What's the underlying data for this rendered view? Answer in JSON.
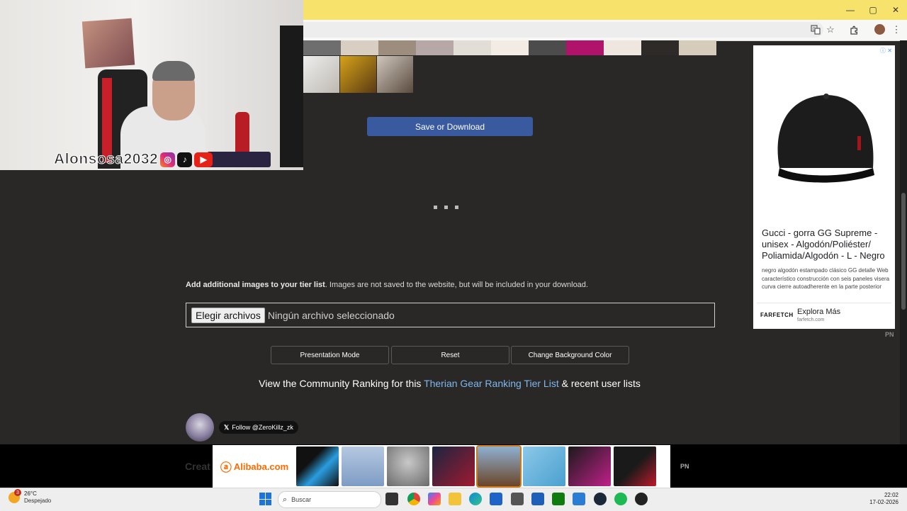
{
  "browser": {
    "window_controls": [
      "—",
      "▢",
      "✕"
    ],
    "toolbar_icons": [
      "translate-icon",
      "bookmark-star-icon",
      "extensions-icon",
      "profile-avatar",
      "more-menu-icon"
    ]
  },
  "webcam": {
    "handle": "Alonsosa2032",
    "socials": [
      "instagram-icon",
      "tiktok-icon",
      "youtube-icon"
    ]
  },
  "tier_list": {
    "save_button": "Save or Download",
    "add_images_bold": "Add additional images to your tier list",
    "add_images_rest": ". Images are not saved to the website, but will be included in your download.",
    "file_button": "Elegir archivos",
    "file_status": "Ningún archivo seleccionado",
    "controls": [
      "Presentation Mode",
      "Reset",
      "Change Background Color"
    ],
    "community_prefix": "View the Community Ranking for this ",
    "community_link": "Therian Gear Ranking Tier List",
    "community_suffix": " & recent user lists",
    "follow_button": "Follow @ZeroKillz_zk",
    "partial_heading": "Creat"
  },
  "right_ad": {
    "title": "Gucci - gorra GG Supreme - unisex - Algodón/Poliéster/ Poliamida/Algodón - L - Negro",
    "description": "negro algodón estampado clásico GG detalle Web característico construcción con seis paneles visera curva cierre autoadherente en la parte posterior",
    "brand": "FARFETCH",
    "cta": "Explora Más",
    "domain": "farfetch.com",
    "corner_label": "PN"
  },
  "bottom_ad": {
    "brand": "Alibaba.com",
    "corner_label": "PN"
  },
  "taskbar": {
    "weather_temp": "26°C",
    "weather_desc": "Despejado",
    "weather_badge": "3",
    "search_label": "Buscar",
    "time": "22:02",
    "date": "17-02-2026"
  },
  "colors": {
    "page_bg": "#292826",
    "save_button": "#3a5aa0",
    "link": "#7fb6ee",
    "tab_bar": "#f7e26b",
    "alibaba": "#ff6a00"
  }
}
